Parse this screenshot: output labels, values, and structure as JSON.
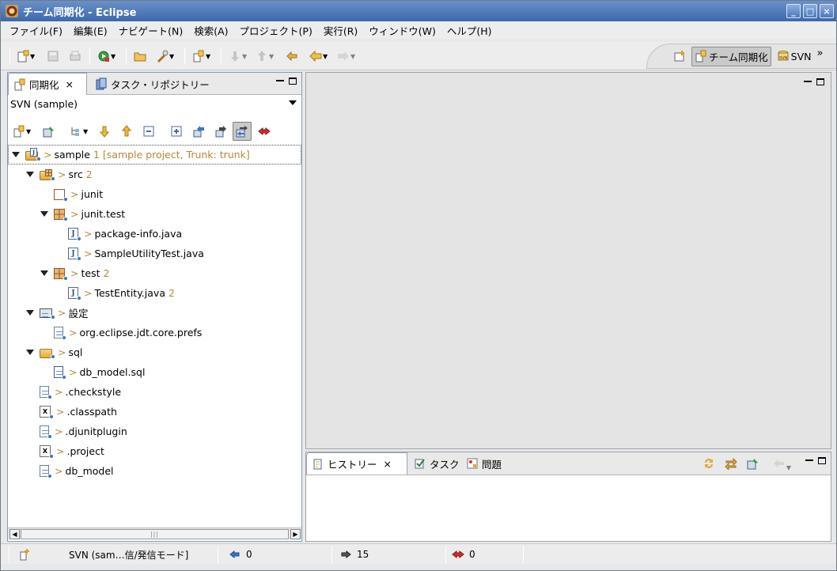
{
  "window": {
    "title": "チーム同期化 - Eclipse",
    "min": "_",
    "max": "□",
    "close": "×"
  },
  "menu": [
    "ファイル(F)",
    "編集(E)",
    "ナビゲート(N)",
    "検索(A)",
    "プロジェクト(P)",
    "実行(R)",
    "ウィンドウ(W)",
    "ヘルプ(H)"
  ],
  "perspectives": {
    "active_label": "チーム同期化",
    "other_label": "SVN",
    "more": "»"
  },
  "left_view": {
    "tabs": [
      {
        "label": "同期化",
        "close": "×"
      },
      {
        "label": "タスク・リポジトリー"
      }
    ],
    "combo_value": "SVN (sample)",
    "tree": [
      {
        "name": "sample",
        "count": "1",
        "meta": "[sample project, Trunk: trunk]",
        "indent": 0,
        "expanded": true,
        "icon": "project"
      },
      {
        "name": "src",
        "count": "2",
        "indent": 1,
        "expanded": true,
        "icon": "srcfolder"
      },
      {
        "name": "junit",
        "count": "",
        "indent": 2,
        "expanded": false,
        "icon": "package-empty"
      },
      {
        "name": "junit.test",
        "count": "",
        "indent": 2,
        "expanded": true,
        "icon": "package"
      },
      {
        "name": "package-info.java",
        "count": "",
        "indent": 3,
        "expanded": false,
        "icon": "java"
      },
      {
        "name": "SampleUtilityTest.java",
        "count": "",
        "indent": 3,
        "expanded": false,
        "icon": "java"
      },
      {
        "name": "test",
        "count": "2",
        "indent": 2,
        "expanded": true,
        "icon": "package"
      },
      {
        "name": "TestEntity.java",
        "count": "2",
        "indent": 3,
        "expanded": false,
        "icon": "java"
      },
      {
        "name": "設定",
        "count": "",
        "indent": 1,
        "expanded": true,
        "icon": "settings"
      },
      {
        "name": "org.eclipse.jdt.core.prefs",
        "count": "",
        "indent": 2,
        "expanded": false,
        "icon": "text"
      },
      {
        "name": "sql",
        "count": "",
        "indent": 1,
        "expanded": true,
        "icon": "folder"
      },
      {
        "name": "db_model.sql",
        "count": "",
        "indent": 2,
        "expanded": false,
        "icon": "sql"
      },
      {
        "name": ".checkstyle",
        "count": "",
        "indent": 1,
        "expanded": false,
        "icon": "text"
      },
      {
        "name": ".classpath",
        "count": "",
        "indent": 1,
        "expanded": false,
        "icon": "xml"
      },
      {
        "name": ".djunitplugin",
        "count": "",
        "indent": 1,
        "expanded": false,
        "icon": "text"
      },
      {
        "name": ".project",
        "count": "",
        "indent": 1,
        "expanded": false,
        "icon": "xml"
      },
      {
        "name": "db_model",
        "count": "",
        "indent": 1,
        "expanded": false,
        "icon": "text"
      }
    ],
    "gt": ">"
  },
  "bottom_view": {
    "tabs": [
      {
        "label": "ヒストリー",
        "close": "×"
      },
      {
        "label": "タスク"
      },
      {
        "label": "問題"
      }
    ]
  },
  "status": {
    "mode": "SVN (sam…信/発信モード]",
    "incoming": "0",
    "outgoing": "15",
    "conflicts": "0"
  },
  "colors": {
    "titlebar": "#3c69ad",
    "decorator": "#b28a3a"
  }
}
